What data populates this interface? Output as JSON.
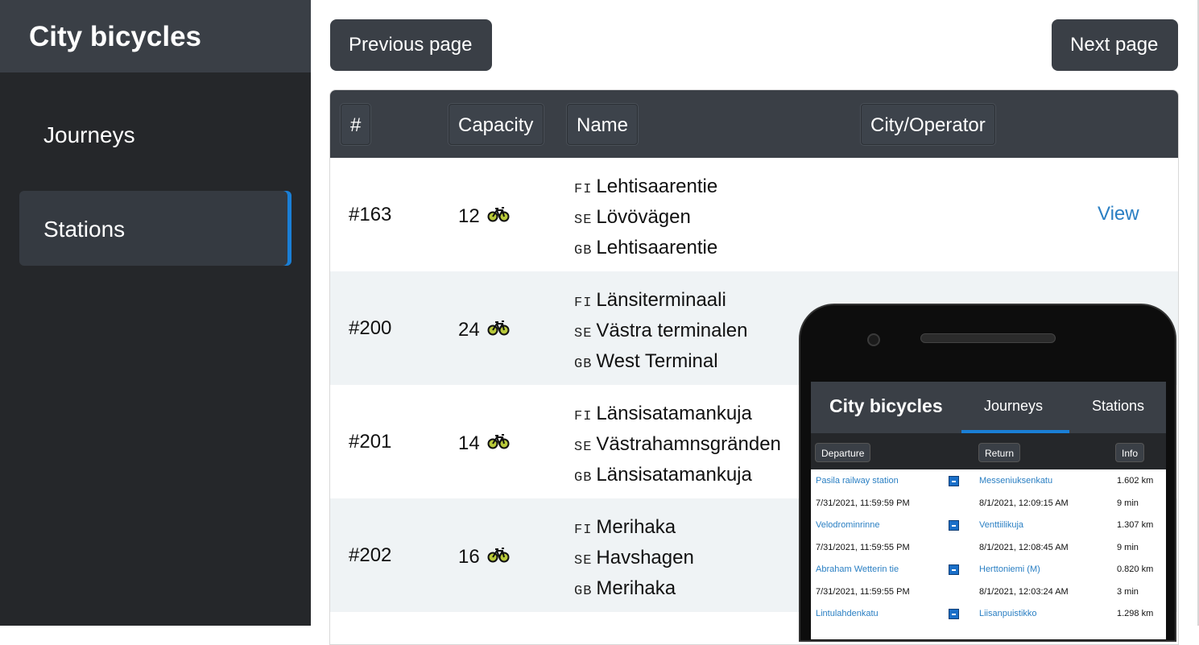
{
  "sidebar": {
    "brand": "City bicycles",
    "items": [
      {
        "label": "Journeys",
        "active": false
      },
      {
        "label": "Stations",
        "active": true
      }
    ]
  },
  "pagination": {
    "previous_label": "Previous page",
    "next_label": "Next page"
  },
  "table": {
    "headers": [
      "#",
      "Capacity",
      "Name",
      "City/Operator"
    ],
    "rows": [
      {
        "id": "#163",
        "capacity": "12",
        "fi": "Lehtisaarentie",
        "se": "Lövövägen",
        "gb": "Lehtisaarentie",
        "action": "View"
      },
      {
        "id": "#200",
        "capacity": "24",
        "fi": "Länsiterminaali",
        "se": "Västra terminalen",
        "gb": "West Terminal"
      },
      {
        "id": "#201",
        "capacity": "14",
        "fi": "Länsisatamankuja",
        "se": "Västrahamnsgränden",
        "gb": "Länsisatamankuja"
      },
      {
        "id": "#202",
        "capacity": "16",
        "fi": "Merihaka",
        "se": "Havshagen",
        "gb": "Merihaka"
      }
    ],
    "lang_codes": {
      "fi": "FI",
      "se": "SE",
      "gb": "GB"
    }
  },
  "phone": {
    "brand": "City bicycles",
    "tabs": [
      "Journeys",
      "Stations"
    ],
    "columns": [
      "Departure",
      "Return",
      "Info"
    ],
    "journeys": [
      {
        "from": "Pasila railway station",
        "to": "Messeniuksenkatu",
        "distance": "1.602 km",
        "dep_time": "7/31/2021, 11:59:59 PM",
        "ret_time": "8/1/2021, 12:09:15 AM",
        "duration": "9 min"
      },
      {
        "from": "Velodrominrinne",
        "to": "Venttiilikuja",
        "distance": "1.307 km",
        "dep_time": "7/31/2021, 11:59:55 PM",
        "ret_time": "8/1/2021, 12:08:45 AM",
        "duration": "9 min"
      },
      {
        "from": "Abraham Wetterin tie",
        "to": "Herttoniemi (M)",
        "distance": "0.820 km",
        "dep_time": "7/31/2021, 11:59:55 PM",
        "ret_time": "8/1/2021, 12:03:24 AM",
        "duration": "3 min"
      },
      {
        "from": "Lintulahdenkatu",
        "to": "Liisanpuistikko",
        "distance": "1.298 km"
      }
    ]
  },
  "colors": {
    "sidebar_bg": "#25272a",
    "header_bg": "#3a3f46",
    "accent": "#1a7fd6",
    "link": "#2a7fc3",
    "row_alt": "#eff3f5"
  }
}
